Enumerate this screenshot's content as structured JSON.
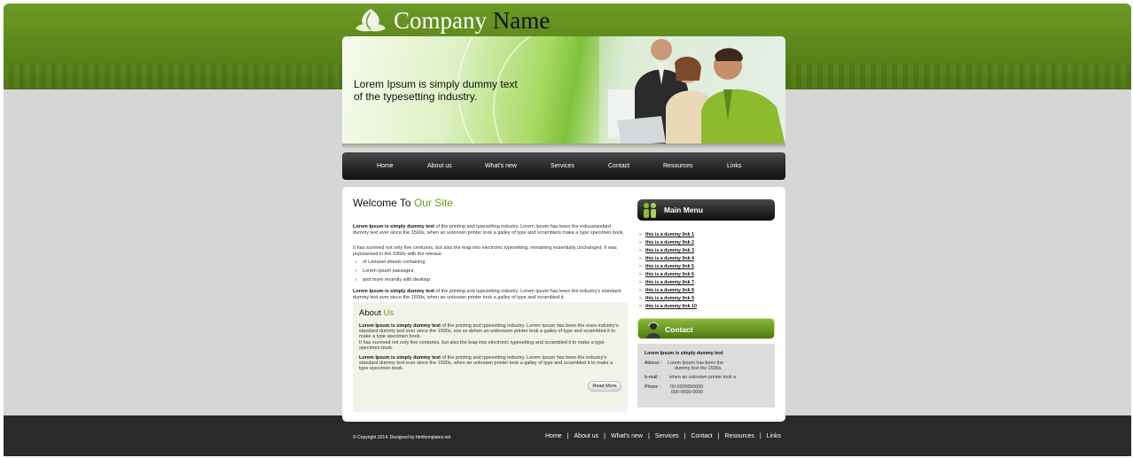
{
  "logo": {
    "company": "Company",
    "name": "Name"
  },
  "banner": {
    "line1": "Lorem Ipsum is simply dummy text",
    "line2": "of the typesetting industry."
  },
  "nav": [
    "Home",
    "About us",
    "What's new",
    "Services",
    "Contact",
    "Resources",
    "Links"
  ],
  "welcome": {
    "prefix": "Welcome To",
    "highlight": "Our Site"
  },
  "intro": {
    "p1_bold": "Lorem Ipsum is simply dummy text",
    "p1_rest": " of the printing and typesetting industry. Lorem Ipsum has been the induustandard dummy text ever since the 1500s, when an unknown printer took a galley of type and scrambleto make a type specimen book.",
    "p2": "It has survived not only five centuries, but also the leap into electronic typesetting, remaining essentially unchanged. It was popularised in the 1960s with the release",
    "bullets": [
      "of Letraset sheets containing",
      "Lorem Ipsum passages,",
      "and more recently with desktop"
    ],
    "p3_bold": "Lorem Ipsum is simply dummy text",
    "p3_rest": " of the printing and typesetting industry. Lorem Ipsum has been the industry's standard dummy text ever since the 1500s, when an unknown printer took a galley of type and scrambled it."
  },
  "about": {
    "title_prefix": "About",
    "title_highlight": "Us",
    "p1_bold": "Lorem Ipsum is simply dummy text",
    "p1_rest": " of the printing and typesetting industry. Lorem Ipsum has been the esea industry's standard dummy text ever since the 1500s, ess ss dehen an unknownn printer took a galley of type and scrambled it to make a type specimen book.",
    "p1_line2": "It has survived not only five centuries, but also the leap into electronic typesetting and scrambled it to make a type specimen book.",
    "p2_bold": "Lorem Ipsum is simply dummy text",
    "p2_rest": " of the printing and typesetting industry. Lorem Ipsum has been the industry's standard dummy text ever since the 1500s, when an unknown printer took a galley of type and scrambled it to make a type specimen book.",
    "read_more": "Read More"
  },
  "main_menu": {
    "title": "Main Menu",
    "links": [
      "this is a dummy link 1",
      "this is a dummy link 2",
      "this is a dummy link 3",
      "this is a dummy link 4",
      "this is a dummy link 5",
      "this is a dummy link 6",
      "this is a dummy link 7",
      "this is a dummy link 8",
      "this is a dummy link 9",
      "this is a dummy link 10"
    ]
  },
  "contact": {
    "title": "Contact",
    "heading": "Lorem Ipsum is simply dummy text",
    "address_label": "Adress :",
    "address_value_1": "Lorem Ipsum has been the",
    "address_value_2": "dummy text the 1500s,",
    "email_label": "b-mail :",
    "email_value": "when an unknown printer took a",
    "phone_label": "Phone :",
    "phone_value_1": "00-0000000000",
    "phone_value_2": "000-0000-0000"
  },
  "footer": {
    "copyright": "© Copyright 2014. Designed by htmltemplates.net",
    "links": [
      "Home",
      "About us",
      "What's new",
      "Services",
      "Contact",
      "Resources",
      "Links"
    ],
    "separator": "|"
  },
  "colors": {
    "accent": "#6a9a1f",
    "header_green": "#5a861a",
    "nav_dark": "#2d2d2d",
    "footer": "#2a2a2a",
    "background": "#d6d6d6"
  }
}
